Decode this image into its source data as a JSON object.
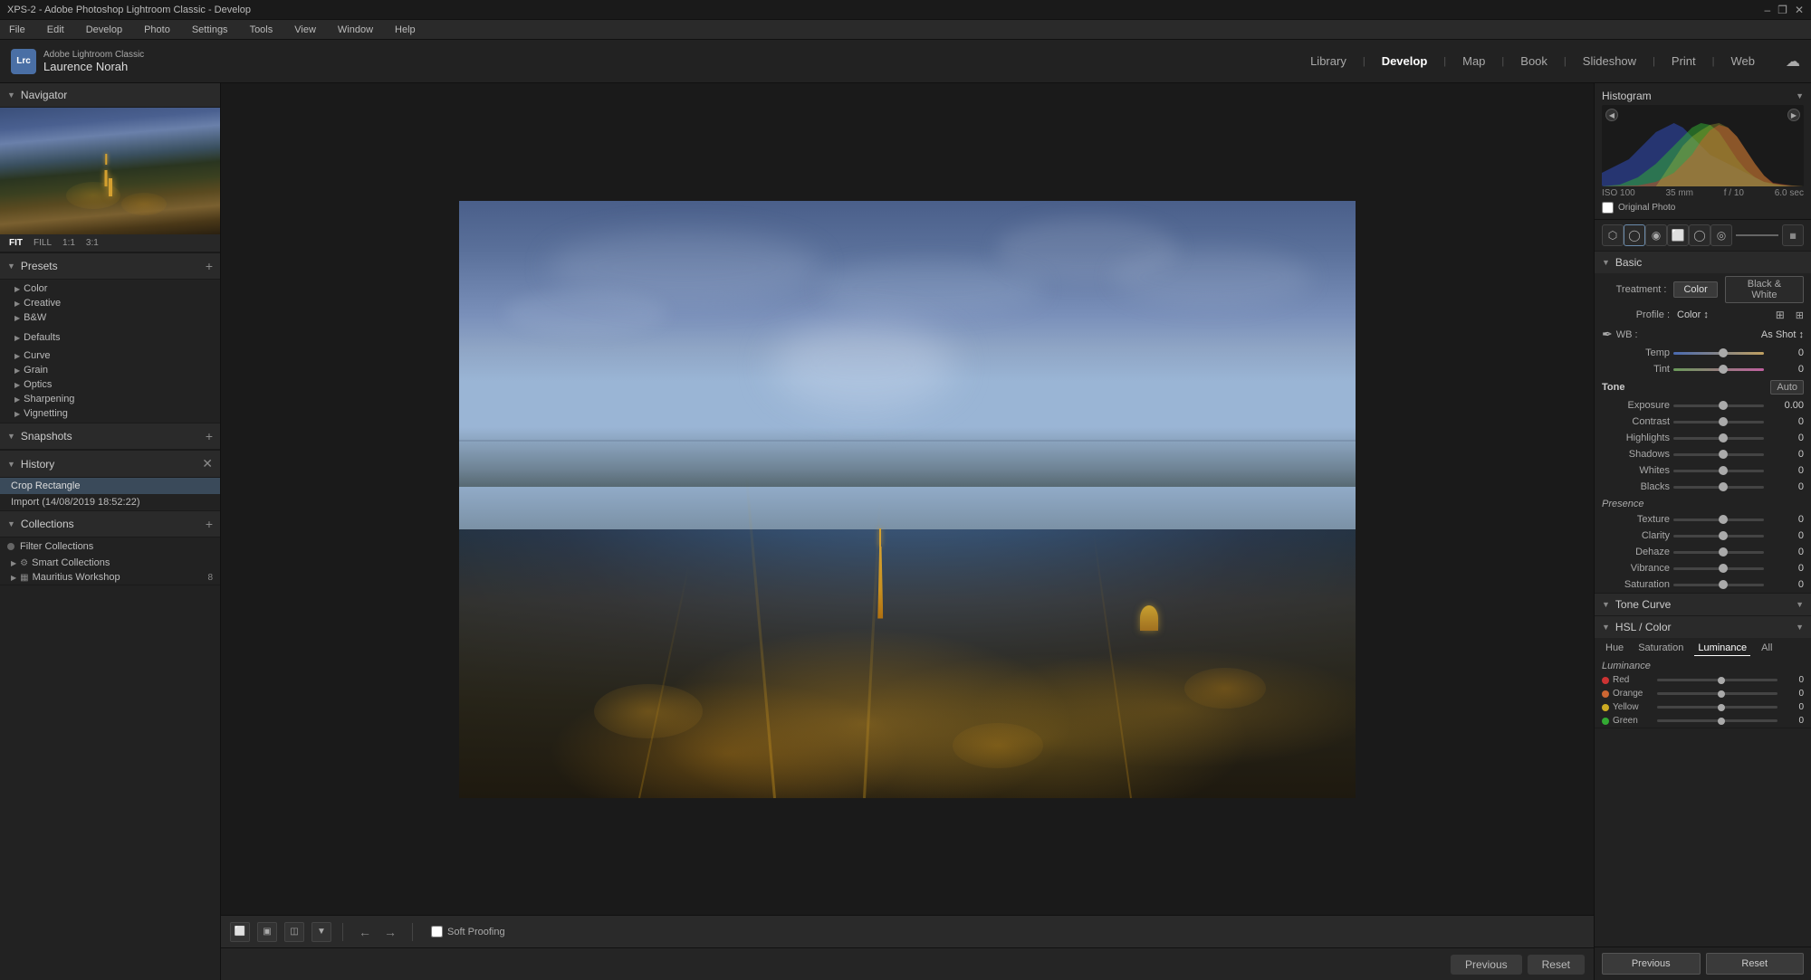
{
  "app": {
    "title": "XPS-2 - Adobe Photoshop Lightroom Classic - Develop",
    "logo": "Lrc",
    "app_name": "Adobe Lightroom Classic",
    "user_name": "Laurence Norah"
  },
  "menubar": {
    "items": [
      "File",
      "Edit",
      "Develop",
      "Photo",
      "Settings",
      "Tools",
      "View",
      "Window",
      "Help"
    ]
  },
  "nav_tabs": {
    "items": [
      "Library",
      "Develop",
      "Map",
      "Book",
      "Slideshow",
      "Print",
      "Web"
    ],
    "active": "Develop"
  },
  "win_controls": {
    "minimize": "–",
    "restore": "❐",
    "close": "✕"
  },
  "left_panel": {
    "navigator": {
      "label": "Navigator",
      "zoom_levels": [
        "FIT",
        "FILL",
        "1:1",
        "3:1"
      ]
    },
    "presets": {
      "label": "Presets",
      "add_btn": "+",
      "groups": [
        {
          "name": "Color",
          "expanded": false
        },
        {
          "name": "Creative",
          "expanded": true
        },
        {
          "name": "B&W",
          "expanded": false
        },
        {
          "name": "Defaults",
          "expanded": false
        },
        {
          "name": "Curve",
          "expanded": false
        },
        {
          "name": "Grain",
          "expanded": false
        },
        {
          "name": "Optics",
          "expanded": false
        },
        {
          "name": "Sharpening",
          "expanded": false
        },
        {
          "name": "Vignetting",
          "expanded": false
        }
      ]
    },
    "snapshots": {
      "label": "Snapshots",
      "add_btn": "+"
    },
    "history": {
      "label": "History",
      "clear_btn": "✕",
      "items": [
        {
          "name": "Crop Rectangle",
          "selected": true
        },
        {
          "name": "Import (14/08/2019 18:52:22)",
          "selected": false
        }
      ]
    },
    "collections": {
      "label": "Collections",
      "add_btn": "+",
      "filter_label": "Filter Collections",
      "items": [
        {
          "type": "smart",
          "name": "Smart Collections",
          "count": ""
        },
        {
          "type": "folder",
          "name": "Mauritius Workshop",
          "count": "8"
        }
      ]
    }
  },
  "toolbar_bottom": {
    "soft_proofing_label": "Soft Proofing"
  },
  "filmstrip": {
    "previous_label": "Previous",
    "reset_label": "Reset"
  },
  "right_panel": {
    "histogram": {
      "label": "Histogram",
      "iso": "ISO 100",
      "lens": "35 mm",
      "aperture": "f / 10",
      "shutter": "6.0 sec",
      "original_photo": "Original Photo"
    },
    "basic": {
      "label": "Basic",
      "treatment_label": "Treatment :",
      "color_btn": "Color",
      "bw_btn": "Black & White",
      "profile_label": "Profile :",
      "profile_value": "Color ↕",
      "wb_label": "WB :",
      "wb_value": "As Shot ↕",
      "temp_label": "Temp",
      "temp_value": "0",
      "tint_label": "Tint",
      "tint_value": "0",
      "tone_label": "Tone",
      "auto_btn": "Auto",
      "exposure_label": "Exposure",
      "exposure_value": "0.00",
      "contrast_label": "Contrast",
      "contrast_value": "0",
      "highlights_label": "Highlights",
      "highlights_value": "0",
      "shadows_label": "Shadows",
      "shadows_value": "0",
      "whites_label": "Whites",
      "whites_value": "0",
      "blacks_label": "Blacks",
      "blacks_value": "0",
      "presence_label": "Presence",
      "texture_label": "Texture",
      "texture_value": "0",
      "clarity_label": "Clarity",
      "clarity_value": "0",
      "dehaze_label": "Dehaze",
      "dehaze_value": "0",
      "vibrance_label": "Vibrance",
      "vibrance_value": "0",
      "saturation_label": "Saturation",
      "saturation_value": "0"
    },
    "tone_curve": {
      "label": "Tone Curve"
    },
    "hsl": {
      "label": "HSL / Color",
      "tabs": [
        "Hue",
        "Saturation",
        "Luminance",
        "All"
      ],
      "active_tab": "Luminance",
      "luminance_label": "Luminance",
      "colors": [
        {
          "name": "Red",
          "color": "#cc3333",
          "value": "0"
        },
        {
          "name": "Orange",
          "color": "#cc6633",
          "value": "0"
        },
        {
          "name": "Yellow",
          "color": "#ccaa22",
          "value": "0"
        },
        {
          "name": "Green",
          "color": "#33aa33",
          "value": "0"
        }
      ]
    },
    "bottom": {
      "previous_label": "Previous",
      "reset_label": "Reset"
    }
  }
}
